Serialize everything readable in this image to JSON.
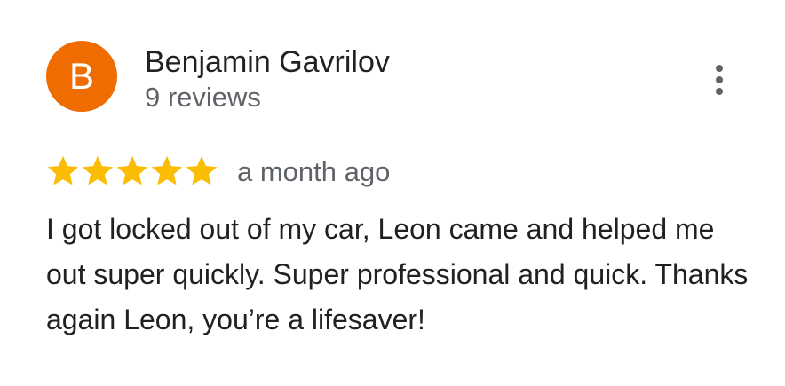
{
  "review": {
    "avatar_letter": "B",
    "avatar_color": "#ef6c00",
    "reviewer_name": "Benjamin Gavrilov",
    "reviewer_reviews": "9 reviews",
    "rating": 5,
    "rating_max": 5,
    "star_color": "#fbbc04",
    "time_ago": "a month ago",
    "text": "I got locked out of my car, Leon came and helped me out super quickly. Super professional and quick. Thanks again Leon, you’re a lifesaver!",
    "more_icon": "more-vert-icon"
  }
}
